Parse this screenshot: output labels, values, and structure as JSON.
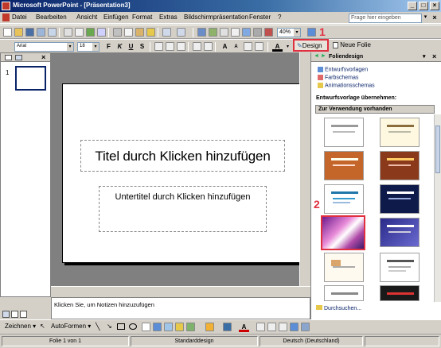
{
  "window": {
    "title": "Microsoft PowerPoint - [Präsentation3]"
  },
  "menu": {
    "items": [
      "Datei",
      "Bearbeiten",
      "Ansicht",
      "Einfügen",
      "Format",
      "Extras",
      "Bildschirmpräsentation",
      "Fenster",
      "?"
    ],
    "help_placeholder": "Frage hier eingeben"
  },
  "toolbar": {
    "zoom": "40%",
    "font_name": "Arial",
    "font_size": "18",
    "design_label": "Design",
    "new_slide_label": "Neue Folie"
  },
  "markers": {
    "one": "1",
    "two": "2"
  },
  "slides_panel": {
    "slide_number": "1"
  },
  "slide": {
    "title_placeholder": "Titel durch Klicken hinzufügen",
    "subtitle_placeholder": "Untertitel durch Klicken hinzufügen"
  },
  "notes": {
    "placeholder": "Klicken Sie, um Notizen hinzuzufügen"
  },
  "task_pane": {
    "title": "Foliendesign",
    "links": [
      "Entwurfsvorlagen",
      "Farbschemas",
      "Animationsschemas"
    ],
    "apply_label": "Entwurfsvorlage übernehmen:",
    "group_label": "Zur Verwendung vorhanden",
    "browse_label": "Durchsuchen..."
  },
  "drawing": {
    "draw_label": "Zeichnen",
    "autoshapes_label": "AutoFormen"
  },
  "status": {
    "slide_info": "Folie 1 von 1",
    "design": "Standarddesign",
    "language": "Deutsch (Deutschland)"
  },
  "colors": {
    "title_bar": "#0a246a",
    "highlight": "#e0303f",
    "link": "#0a246a"
  }
}
